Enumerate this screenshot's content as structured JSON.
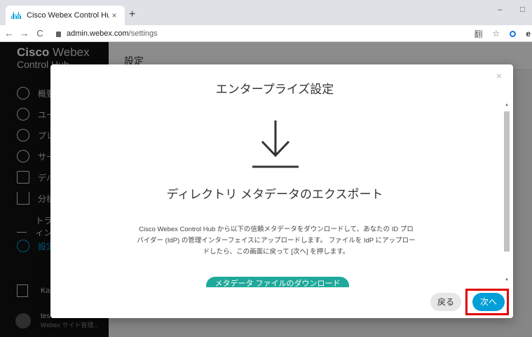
{
  "browser": {
    "tab_title": "Cisco Webex Control Hub",
    "tab_close": "×",
    "new_tab": "+",
    "url_host": "admin.webex.com",
    "url_path": "/settings",
    "nav_back": "←",
    "nav_forward": "→",
    "nav_reload": "C",
    "minimize": "–",
    "maximize": "□",
    "translate_icon": "翻",
    "star_icon": "☆",
    "profile_icon": "e"
  },
  "sidebar": {
    "brand_bold": "Cisco",
    "brand_light": "Webex",
    "brand_sub": "Control Hub",
    "items": [
      {
        "label": "概要"
      },
      {
        "label": "ユーザー"
      },
      {
        "label": "プレイス"
      },
      {
        "label": "サービス"
      },
      {
        "label": "デバイス"
      },
      {
        "label": "分析"
      },
      {
        "label": "トラブルシューティング"
      },
      {
        "label": "設定"
      }
    ],
    "org_label": "Kao",
    "user_name": "tes",
    "user_role": "Webex サイト管理..."
  },
  "main": {
    "page_title": "設定"
  },
  "modal": {
    "title": "エンタープライズ設定",
    "close": "×",
    "step_title": "ディレクトリ メタデータのエクスポート",
    "desc_line1": "Cisco Webex Control Hub から以下の信頼メタデータをダウンロードして、あなたの ID プロ",
    "desc_line2": "バイダー (IdP) の管理インターフェイスにアップロードします。 ファイルを IdP にアップロー",
    "desc_line3": "ドしたら、この画面に戻って [次へ] を押します。",
    "download_button": "メタデータ ファイルのダウンロード",
    "back_button": "戻る",
    "next_button": "次へ",
    "scroll_up": "▲",
    "scroll_down": "▼"
  },
  "colors": {
    "accent": "#049fd9",
    "download_green": "#1fa99a",
    "highlight_red": "#e00000",
    "sidebar_bg": "#121212"
  }
}
